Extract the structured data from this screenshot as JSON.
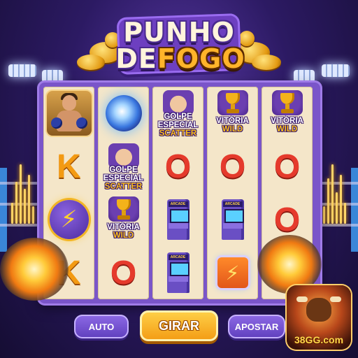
{
  "title": {
    "line1": "PUNHO",
    "line2_prefix": "DE",
    "line2_suffix": "FOGO"
  },
  "reels": [
    {
      "symbols": [
        {
          "kind": "boxer",
          "icon": "boxer-icon"
        },
        {
          "kind": "letter",
          "text": "K"
        },
        {
          "kind": "lightning-coin",
          "glyph": "⚡",
          "icon": "lightning-coin-icon"
        },
        {
          "kind": "letter",
          "text": "K"
        }
      ]
    },
    {
      "symbols": [
        {
          "kind": "orb",
          "icon": "energy-orb-icon"
        },
        {
          "kind": "scatter",
          "line1": "GOLPE",
          "line2": "ESPECIAL",
          "line3": "SCATTER"
        },
        {
          "kind": "wild",
          "line1": "VITÓRIA",
          "line2": "WILD"
        },
        {
          "kind": "letter",
          "text": "O"
        }
      ]
    },
    {
      "symbols": [
        {
          "kind": "scatter",
          "line1": "GOLPE",
          "line2": "ESPECIAL",
          "line3": "SCATTER"
        },
        {
          "kind": "letter",
          "text": "O"
        },
        {
          "kind": "arcade",
          "marquee": "ARCADE"
        },
        {
          "kind": "arcade",
          "marquee": "ARCADE"
        }
      ]
    },
    {
      "symbols": [
        {
          "kind": "wild",
          "line1": "VITÓRIA",
          "line2": "WILD"
        },
        {
          "kind": "letter",
          "text": "O"
        },
        {
          "kind": "arcade",
          "marquee": "ARCADE"
        },
        {
          "kind": "lightning-tile",
          "glyph": "⚡",
          "icon": "lightning-tile-icon"
        }
      ]
    },
    {
      "symbols": [
        {
          "kind": "wild",
          "line1": "VITÓRIA",
          "line2": "WILD"
        },
        {
          "kind": "letter",
          "text": "O"
        },
        {
          "kind": "letter",
          "text": "O"
        },
        {
          "kind": "burst",
          "icon": "explosion-icon"
        }
      ]
    }
  ],
  "controls": {
    "auto_label": "AUTO",
    "spin_label": "GIRAR",
    "bet_label": "APOSTAR"
  },
  "logo": {
    "text": "38GG.com"
  },
  "colors": {
    "frame": "#7a55c9",
    "reel_bg": "#f4e6c9",
    "accent": "#f39a12",
    "button": "#6f4bd0"
  }
}
